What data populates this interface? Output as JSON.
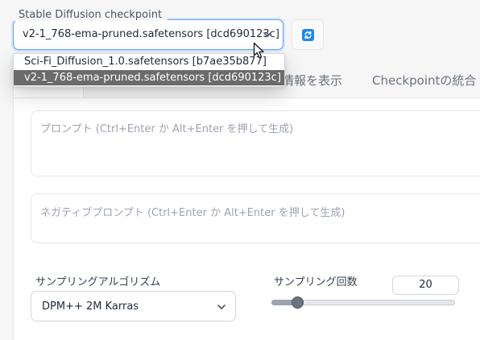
{
  "checkpoint": {
    "label": "Stable Diffusion checkpoint",
    "selected": "v2-1_768-ema-pruned.safetensors [dcd690123c]",
    "options": [
      "Sci-Fi_Diffusion_1.0.safetensors [b7ae35b877]",
      "v2-1_768-ema-pruned.safetensors [dcd690123c]"
    ],
    "highlighted_option_index": 1
  },
  "tabs": [
    {
      "label": "情報を表示"
    },
    {
      "label": "Checkpointの統合"
    }
  ],
  "prompt": {
    "placeholder": "プロンプト (Ctrl+Enter か Alt+Enter を押して生成)"
  },
  "negative_prompt": {
    "placeholder": "ネガティブプロンプト (Ctrl+Enter か Alt+Enter を押して生成)"
  },
  "sampler": {
    "label": "サンプリングアルゴリズム",
    "value": "DPM++ 2M Karras"
  },
  "steps": {
    "label": "サンプリング回数",
    "value": "20",
    "slider_min": 1,
    "slider_max": 150,
    "slider_value": 20
  },
  "colors": {
    "focus_border": "#60a5fa",
    "refresh_icon": "#1e88e5",
    "highlight_item": "#6b6b6b"
  },
  "icons": {
    "refresh": "refresh-icon",
    "dropdown": "chevron-down-icon",
    "cursor": "mouse-cursor-icon"
  }
}
